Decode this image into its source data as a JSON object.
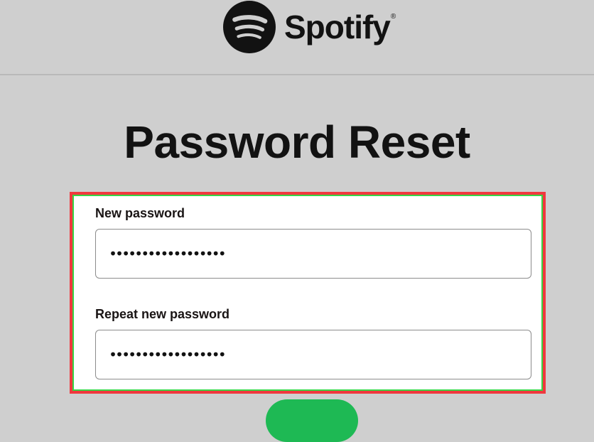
{
  "header": {
    "brand": "Spotify",
    "trademark": "®",
    "logo_icon": "spotify-logo-icon"
  },
  "page": {
    "title": "Password Reset"
  },
  "form": {
    "new_password_label": "New password",
    "new_password_value": "••••••••••••••••••",
    "repeat_password_label": "Repeat new password",
    "repeat_password_value": "••••••••••••••••••"
  },
  "colors": {
    "brand_green": "#1eb954",
    "highlight_red": "#f0383e",
    "highlight_green": "#36d646",
    "background": "#cfcfcf"
  }
}
